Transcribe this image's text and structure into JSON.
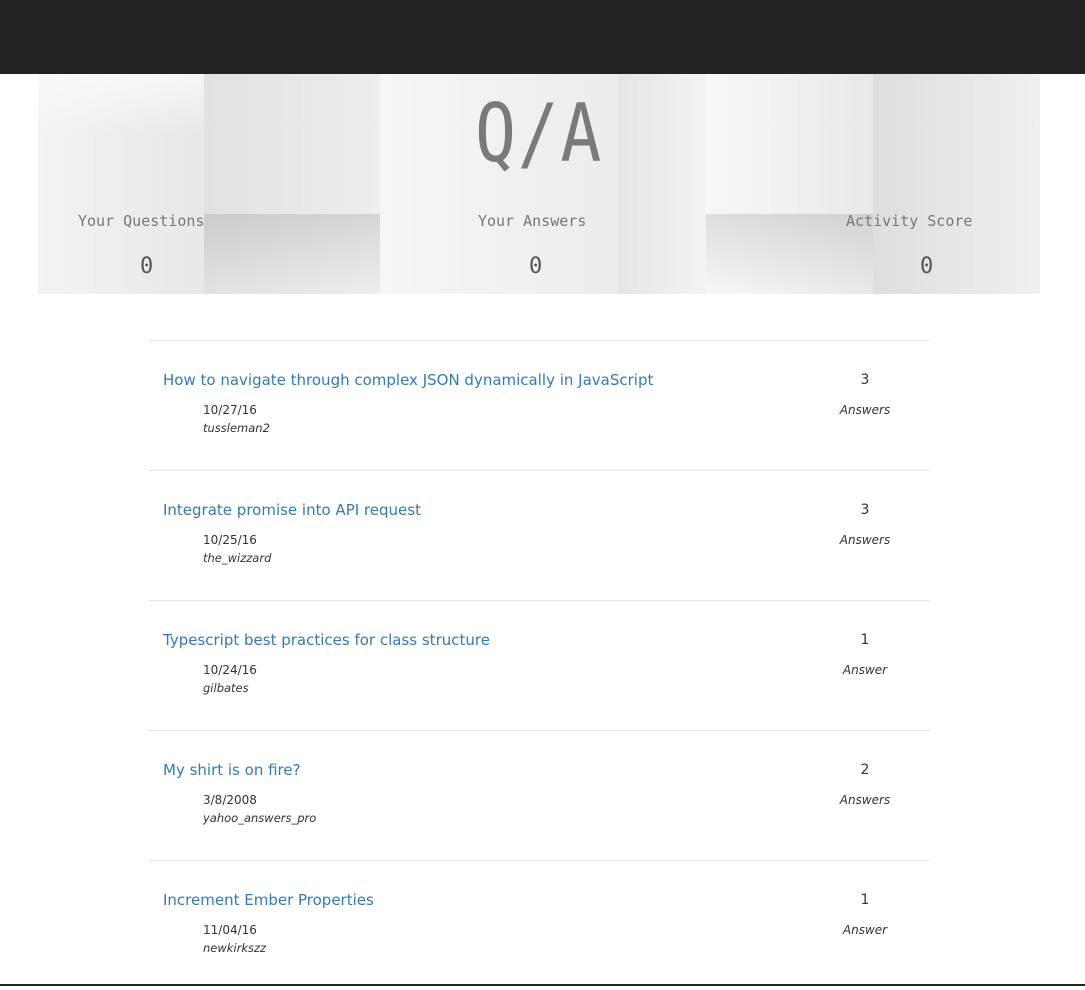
{
  "hero": {
    "title": "Q/A",
    "stats": [
      {
        "label": "Your Questions",
        "value": "0"
      },
      {
        "label": "Your Answers",
        "value": "0"
      },
      {
        "label": "Activity Score",
        "value": "0"
      }
    ]
  },
  "questions": [
    {
      "title": "How to navigate through complex JSON dynamically in JavaScript",
      "date": "10/27/16",
      "user": "tussleman2",
      "count": "3",
      "count_label": "Answers"
    },
    {
      "title": "Integrate promise into API request",
      "date": "10/25/16",
      "user": "the_wizzard",
      "count": "3",
      "count_label": "Answers"
    },
    {
      "title": "Typescript best practices for class structure",
      "date": "10/24/16",
      "user": "gilbates",
      "count": "1",
      "count_label": "Answer"
    },
    {
      "title": "My shirt is on fire?",
      "date": "3/8/2008",
      "user": "yahoo_answers_pro",
      "count": "2",
      "count_label": "Answers"
    },
    {
      "title": "Increment Ember Properties",
      "date": "11/04/16",
      "user": "newkirkszz",
      "count": "1",
      "count_label": "Answer"
    }
  ],
  "colors": {
    "topbar": "#222222",
    "link": "#337ab7",
    "hero_text": "#7a7a7a"
  }
}
